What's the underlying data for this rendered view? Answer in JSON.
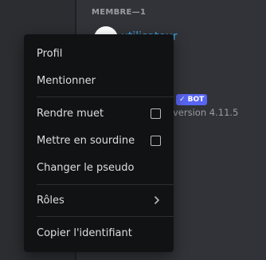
{
  "member_list": {
    "section_header": "MEMBRE—1",
    "member_name": "utilisateur",
    "bot_badge": "✓ BOT",
    "member_status": "version 4.11.5"
  },
  "context_menu": {
    "items": [
      {
        "label": "Profil"
      },
      {
        "label": "Mentionner"
      },
      {
        "label": "Rendre muet",
        "control": "checkbox",
        "checked": false
      },
      {
        "label": "Mettre en sourdine",
        "control": "checkbox",
        "checked": false
      },
      {
        "label": "Changer le pseudo"
      },
      {
        "label": "Rôles",
        "control": "chevron-right-icon"
      },
      {
        "label": "Copier l'identifiant"
      }
    ]
  },
  "colors": {
    "menu_background": "#111214",
    "menu_text": "#dcdee2",
    "member_pane": "#313338",
    "sidebar": "#2b2d31",
    "bot_badge": "#5865f2",
    "member_name": "#3fa3e8"
  }
}
